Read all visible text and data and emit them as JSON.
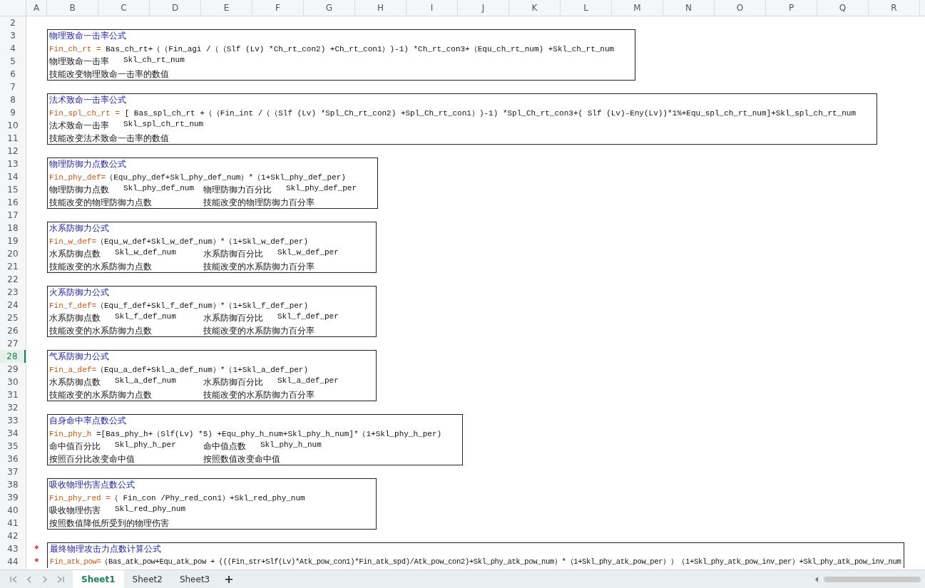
{
  "columns": [
    "A",
    "B",
    "C",
    "D",
    "E",
    "F",
    "G",
    "H",
    "I",
    "J",
    "K",
    "L",
    "M",
    "N",
    "O",
    "P",
    "Q",
    "R"
  ],
  "row_numbers": [
    {
      "label": "2",
      "selected": false
    },
    {
      "label": "3",
      "selected": false
    },
    {
      "label": "4",
      "selected": false
    },
    {
      "label": "5",
      "selected": false
    },
    {
      "label": "6",
      "selected": false
    },
    {
      "label": "7",
      "selected": false
    },
    {
      "label": "8",
      "selected": false
    },
    {
      "label": "9",
      "selected": false
    },
    {
      "label": "10",
      "selected": false
    },
    {
      "label": "11",
      "selected": false
    },
    {
      "label": "12",
      "selected": false
    },
    {
      "label": "13",
      "selected": false
    },
    {
      "label": "14",
      "selected": false
    },
    {
      "label": "15",
      "selected": false
    },
    {
      "label": "16",
      "selected": false
    },
    {
      "label": "17",
      "selected": false
    },
    {
      "label": "18",
      "selected": false
    },
    {
      "label": "19",
      "selected": false
    },
    {
      "label": "20",
      "selected": false
    },
    {
      "label": "21",
      "selected": false
    },
    {
      "label": "22",
      "selected": false
    },
    {
      "label": "23",
      "selected": false
    },
    {
      "label": "24",
      "selected": false
    },
    {
      "label": "25",
      "selected": false
    },
    {
      "label": "26",
      "selected": false
    },
    {
      "label": "27",
      "selected": false
    },
    {
      "label": "28",
      "selected": true
    },
    {
      "label": "29",
      "selected": false
    },
    {
      "label": "30",
      "selected": false
    },
    {
      "label": "31",
      "selected": false
    },
    {
      "label": "32",
      "selected": false
    },
    {
      "label": "33",
      "selected": false
    },
    {
      "label": "34",
      "selected": false
    },
    {
      "label": "35",
      "selected": false
    },
    {
      "label": "36",
      "selected": false
    },
    {
      "label": "37",
      "selected": false
    },
    {
      "label": "38",
      "selected": false
    },
    {
      "label": "39",
      "selected": false
    },
    {
      "label": "40",
      "selected": false
    },
    {
      "label": "41",
      "selected": false
    },
    {
      "label": "42",
      "selected": false
    },
    {
      "label": "43",
      "selected": false
    },
    {
      "label": "44",
      "selected": false
    }
  ],
  "content": [
    {
      "kind": "gap"
    },
    {
      "kind": "box",
      "lines": [
        {
          "kind": "title",
          "text": "物理致命一击率公式"
        },
        {
          "kind": "formula",
          "result": "Fin_ch_rt =",
          "expression": " Bas_ch_rt+（（Fin_agi /（（Slf (Lv) *Ch_rt_con2) +Ch_rt_con1）)-1) *Ch_rt_con3+（Equ_ch_rt_num) +Skl_ch_rt_num"
        },
        {
          "kind": "cells",
          "cells": [
            "物理致命一击率",
            "Skl_ch_rt_num"
          ]
        },
        {
          "kind": "cells",
          "cells": [
            "技能改变物理致命一击率的数值"
          ]
        }
      ]
    },
    {
      "kind": "gap"
    },
    {
      "kind": "box",
      "lines": [
        {
          "kind": "title",
          "text": "法术致命一击率公式"
        },
        {
          "kind": "formula",
          "result": "Fin_spl_ch_rt =",
          "expression": " [ Bas_spl_ch_rt +（（Fin_int /（（Slf (Lv) *Spl_Ch_rt_con2) +Spl_Ch_rt_con1）)-1) *Spl_Ch_rt_con3+( Slf (Lv)-Eny(Lv))*1%+Equ_spl_ch_rt_num]+Skl_spl_ch_rt_num"
        },
        {
          "kind": "cells",
          "cells": [
            "法术致命一击率",
            "Skl_spl_ch_rt_num"
          ]
        },
        {
          "kind": "cells",
          "cells": [
            "技能改变法术致命一击率的数值"
          ]
        }
      ]
    },
    {
      "kind": "gap"
    },
    {
      "kind": "box",
      "lines": [
        {
          "kind": "title",
          "text": "物理防御力点数公式"
        },
        {
          "kind": "formula",
          "result": "Fin_phy_def=",
          "expression": "（Equ_phy_def+Skl_phy_def_num）*（1+Skl_phy_def_per)"
        },
        {
          "kind": "cells",
          "cells": [
            "物理防御力点数",
            "Skl_phy_def_num",
            "物理防御力百分比",
            "Skl_phy_def_per"
          ]
        },
        {
          "kind": "cells",
          "cells": [
            "技能改变的物理防御力点数",
            "技能改变的物理防御力百分率"
          ]
        }
      ]
    },
    {
      "kind": "gap"
    },
    {
      "kind": "box",
      "lines": [
        {
          "kind": "title",
          "text": "水系防御力公式"
        },
        {
          "kind": "formula",
          "result": "Fin_w_def=",
          "expression": "（Equ_w_def+Skl_w_def_num）*（1+Skl_w_def_per)"
        },
        {
          "kind": "cells",
          "cells": [
            "水系防御点数",
            "Skl_w_def_num",
            "水系防御百分比",
            "Skl_w_def_per"
          ]
        },
        {
          "kind": "cells",
          "cells": [
            "技能改变的水系防御力点数",
            "技能改变的水系防御力百分率"
          ]
        }
      ]
    },
    {
      "kind": "gap"
    },
    {
      "kind": "box",
      "lines": [
        {
          "kind": "title",
          "text": "火系防御力公式"
        },
        {
          "kind": "formula",
          "result": "Fin_f_def=",
          "expression": "（Equ_f_def+Skl_f_def_num）*（1+Skl_f_def_per)"
        },
        {
          "kind": "cells",
          "cells": [
            "水系防御点数",
            "Skl_f_def_num",
            "水系防御百分比",
            "Skl_f_def_per"
          ]
        },
        {
          "kind": "cells",
          "cells": [
            "技能改变的水系防御力点数",
            "技能改变的水系防御力百分率"
          ]
        }
      ]
    },
    {
      "kind": "gap"
    },
    {
      "kind": "box",
      "lines": [
        {
          "kind": "title",
          "text": "气系防御力公式"
        },
        {
          "kind": "formula",
          "result": "Fin_a_def=",
          "expression": "（Equ_a_def+Skl_a_def_num）*（1+Skl_a_def_per)"
        },
        {
          "kind": "cells",
          "cells": [
            "水系防御点数",
            "Skl_a_def_num",
            "水系防御百分比",
            "Skl_a_def_per"
          ]
        },
        {
          "kind": "cells",
          "cells": [
            "技能改变的水系防御力点数",
            "技能改变的水系防御力百分率"
          ]
        }
      ]
    },
    {
      "kind": "gap"
    },
    {
      "kind": "box",
      "lines": [
        {
          "kind": "title",
          "text": "自身命中率点数公式"
        },
        {
          "kind": "formula",
          "result": "Fin_phy_h",
          "expression": " =[Bas_phy_h+（Slf(Lv) *5) +Equ_phy_h_num+Skl_phy_h_num]*（1+Skl_phy_h_per)"
        },
        {
          "kind": "cells",
          "cells": [
            "命中值百分比",
            "Skl_phy_h_per",
            "命中值点数",
            "Skl_phy_h_num"
          ]
        },
        {
          "kind": "cells",
          "cells": [
            "按照百分比改变命中值",
            "按照数值改变命中值"
          ]
        }
      ]
    },
    {
      "kind": "gap"
    },
    {
      "kind": "box",
      "lines": [
        {
          "kind": "title",
          "text": "吸收物理伤害点数公式"
        },
        {
          "kind": "formula",
          "result": "Fin_phy_red =",
          "expression": "（ Fin_con /Phy_red_con1）+Skl_red_phy_num"
        },
        {
          "kind": "cells",
          "cells": [
            "吸收物理伤害",
            "Skl_red_phy_num"
          ]
        },
        {
          "kind": "cells",
          "cells": [
            "按照数值降低所受到的物理伤害"
          ]
        }
      ]
    },
    {
      "kind": "gap"
    },
    {
      "kind": "box",
      "continues": true,
      "lines": [
        {
          "kind": "title",
          "text": "最终物理攻击力点数计算公式",
          "marker": "*"
        },
        {
          "kind": "formula",
          "result": "Fin_atk_pow=",
          "expression": "（Bas_atk_pow+Equ_atk_pow + (((Fin_str+Slf(Lv)*Atk_pow_con1)*Fin_atk_spd)/Atk_pow_con2)+Skl_phy_atk_pow_num）*（1+Skl_phy_atk_pow_per））（1+Skl_phy_atk_pow_inv_per）+Skl_phy_atk_pow_inv_num",
          "marker": "*"
        }
      ]
    }
  ],
  "sheet_tabs": [
    {
      "label": "Sheet1",
      "selected": true
    },
    {
      "label": "Sheet2",
      "selected": false
    },
    {
      "label": "Sheet3",
      "selected": false
    }
  ],
  "add_sheet": "+"
}
